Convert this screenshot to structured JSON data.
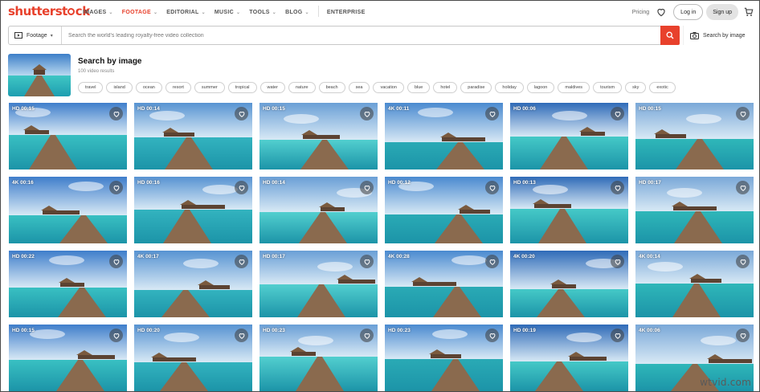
{
  "nav": {
    "logo": "shutterstock",
    "links": [
      {
        "label": "IMAGES",
        "has_menu": true,
        "active": false
      },
      {
        "label": "FOOTAGE",
        "has_menu": true,
        "active": true
      },
      {
        "label": "EDITORIAL",
        "has_menu": true,
        "active": false
      },
      {
        "label": "MUSIC",
        "has_menu": true,
        "active": false
      },
      {
        "label": "TOOLS",
        "has_menu": true,
        "active": false
      },
      {
        "label": "BLOG",
        "has_menu": true,
        "active": false
      },
      {
        "label": "ENTERPRISE",
        "has_menu": false,
        "active": false
      }
    ],
    "pricing": "Pricing",
    "login": "Log in",
    "signup": "Sign up"
  },
  "search": {
    "media_type": "Footage",
    "placeholder": "Search the world's leading royalty-free video collection",
    "search_by_image": "Search by image"
  },
  "results": {
    "title": "Search by image",
    "count": "100 video results",
    "tags": [
      "travel",
      "island",
      "ocean",
      "resort",
      "summer",
      "tropical",
      "water",
      "nature",
      "beach",
      "sea",
      "vacation",
      "blue",
      "hotel",
      "paradise",
      "holiday",
      "lagoon",
      "maldives",
      "tourism",
      "sky",
      "exotic"
    ]
  },
  "videos": [
    {
      "label": "HD 00:15"
    },
    {
      "label": "HD 00:14"
    },
    {
      "label": "HD 00:15"
    },
    {
      "label": "4K 00:11"
    },
    {
      "label": "HD 00:06"
    },
    {
      "label": "HD 00:15"
    },
    {
      "label": "4K 00:16"
    },
    {
      "label": "HD 00:16"
    },
    {
      "label": "HD 00:14"
    },
    {
      "label": "HD 00:12"
    },
    {
      "label": "HD 00:13"
    },
    {
      "label": "HD 00:17"
    },
    {
      "label": "HD 00:22"
    },
    {
      "label": "4K 00:17"
    },
    {
      "label": "HD 00:17"
    },
    {
      "label": "4K 00:28"
    },
    {
      "label": "4K 00:20"
    },
    {
      "label": "4K 00:14"
    },
    {
      "label": "HD 00:15"
    },
    {
      "label": "HD 00:20"
    },
    {
      "label": "HD 00:23"
    },
    {
      "label": "HD 00:23"
    },
    {
      "label": "HD 00:19"
    },
    {
      "label": "4K 00:06"
    }
  ],
  "watermark": "wtvid.com",
  "colors": {
    "brand": "#e8412c",
    "sea": "#3cc4c0",
    "sky": "#5a9ad8",
    "pier": "#8a6a4e"
  }
}
